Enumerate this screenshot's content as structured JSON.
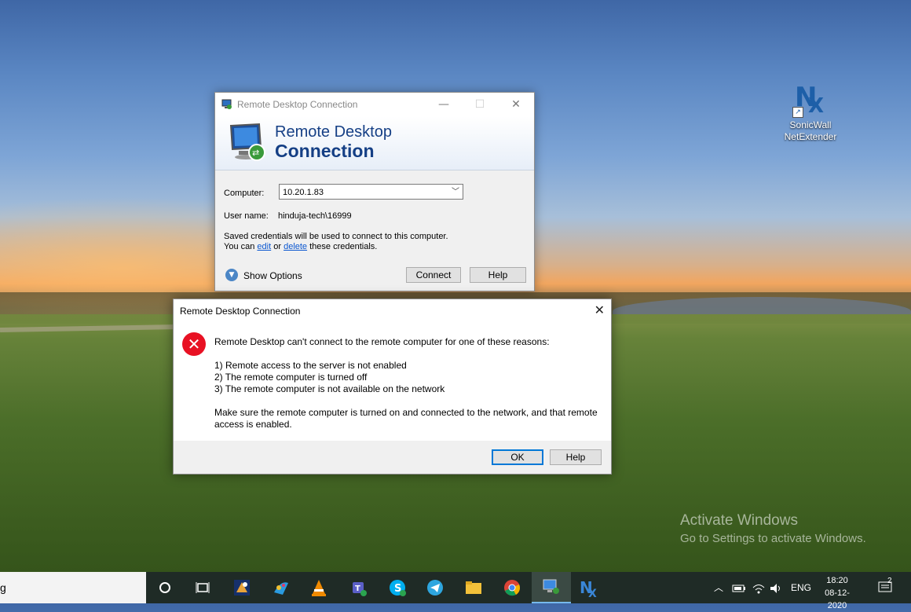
{
  "desktop": {
    "icon_label_line1": "SonicWall",
    "icon_label_line2": "NetExtender",
    "watermark_title": "Activate Windows",
    "watermark_sub": "Go to Settings to activate Windows."
  },
  "rdc": {
    "window_title": "Remote Desktop Connection",
    "banner_line1": "Remote Desktop",
    "banner_line2": "Connection",
    "computer_label": "Computer:",
    "computer_value": "10.20.1.83",
    "username_label": "User name:",
    "username_value": "hinduja-tech\\16999",
    "creds_line1": "Saved credentials will be used to connect to this computer.",
    "creds_line2_a": "You can",
    "creds_edit": "edit",
    "creds_or": "or",
    "creds_delete": "delete",
    "creds_line2_b": "these credentials.",
    "show_options": "Show Options",
    "connect": "Connect",
    "help": "Help"
  },
  "error": {
    "title": "Remote Desktop Connection",
    "intro": "Remote Desktop can't connect to the remote computer for one of these reasons:",
    "reasons": [
      "1) Remote access to the server is not enabled",
      "2) The remote computer is turned off",
      "3) The remote computer is not available on the network"
    ],
    "advice_line1": "Make sure the remote computer is turned on and connected to the network, and that remote",
    "advice_line2": "access is enabled.",
    "ok": "OK",
    "help": "Help"
  },
  "taskbar": {
    "search_text": "g",
    "lang": "ENG",
    "time": "18:20",
    "date": "08-12-2020",
    "notifications": "2"
  }
}
